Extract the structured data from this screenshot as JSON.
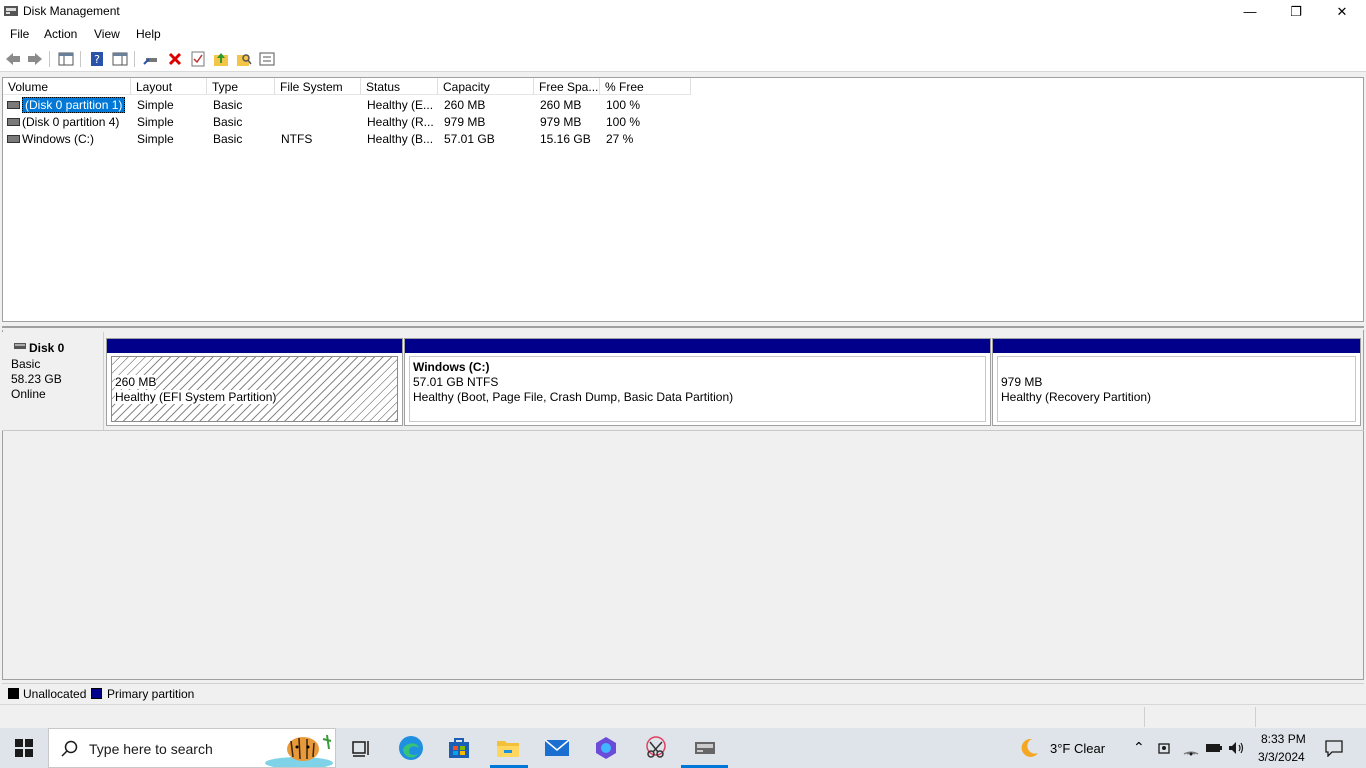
{
  "window": {
    "title": "Disk Management",
    "controls": {
      "minimize": "—",
      "restore": "❐",
      "close": "✕"
    }
  },
  "menu": [
    "File",
    "Action",
    "View",
    "Help"
  ],
  "volumes": {
    "columns": [
      "Volume",
      "Layout",
      "Type",
      "File System",
      "Status",
      "Capacity",
      "Free Spa...",
      "% Free"
    ],
    "rows": [
      {
        "volume": "(Disk 0 partition 1)",
        "layout": "Simple",
        "type": "Basic",
        "fs": "",
        "status": "Healthy (E...",
        "capacity": "260 MB",
        "free": "260 MB",
        "pct": "100 %"
      },
      {
        "volume": "(Disk 0 partition 4)",
        "layout": "Simple",
        "type": "Basic",
        "fs": "",
        "status": "Healthy (R...",
        "capacity": "979 MB",
        "free": "979 MB",
        "pct": "100 %"
      },
      {
        "volume": "Windows (C:)",
        "layout": "Simple",
        "type": "Basic",
        "fs": "NTFS",
        "status": "Healthy (B...",
        "capacity": "57.01 GB",
        "free": "15.16 GB",
        "pct": "27 %"
      }
    ]
  },
  "disk": {
    "name": "Disk 0",
    "kind": "Basic",
    "size": "58.23 GB",
    "state": "Online",
    "partitions": [
      {
        "title": "",
        "size": "260 MB",
        "status": "Healthy (EFI System Partition)"
      },
      {
        "title": "Windows  (C:)",
        "size": "57.01 GB NTFS",
        "status": "Healthy (Boot, Page File, Crash Dump, Basic Data Partition)"
      },
      {
        "title": "",
        "size": "979 MB",
        "status": "Healthy (Recovery Partition)"
      }
    ]
  },
  "legend": {
    "unallocated": "Unallocated",
    "primary": "Primary partition"
  },
  "colors": {
    "primary_bar": "#00008a",
    "selection": "#0078d7",
    "accent": "#0078d7"
  },
  "taskbar": {
    "search_placeholder": "Type here to search",
    "weather": "3°F  Clear",
    "time": "8:33 PM",
    "date": "3/3/2024"
  }
}
